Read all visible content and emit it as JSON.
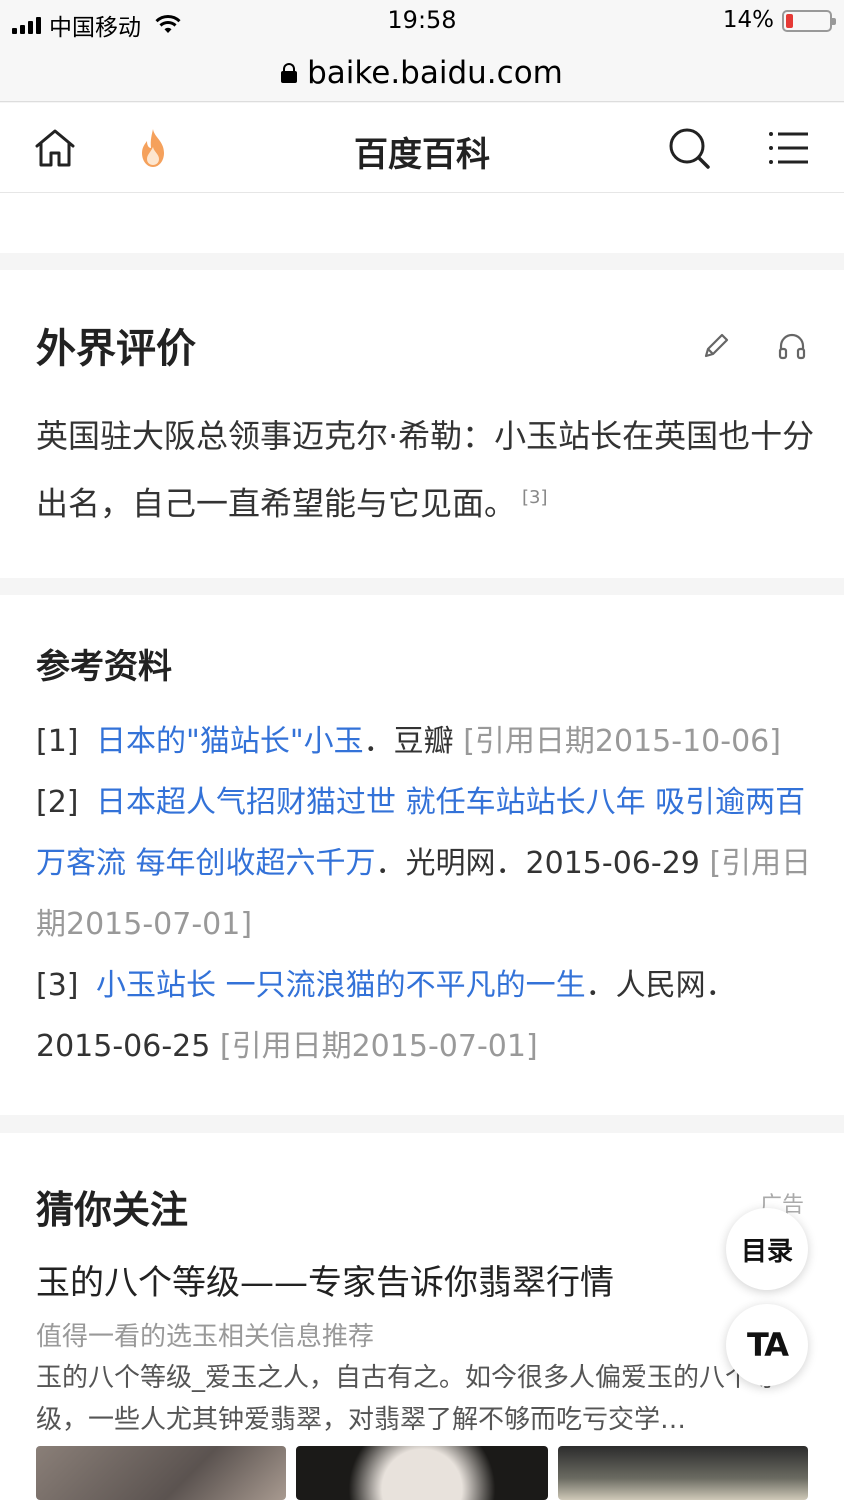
{
  "status_bar": {
    "carrier": "中国移动",
    "time": "19:58",
    "battery": "14%",
    "battery_level": 0.14
  },
  "url_bar": {
    "url": "baike.baidu.com"
  },
  "header": {
    "title": "百度百科",
    "icons": [
      "home-icon",
      "fire-icon",
      "search-icon",
      "menu-icon"
    ]
  },
  "external_review": {
    "title": "外界评价",
    "text": "英国驻大阪总领事迈克尔·希勒：小玉站长在英国也十分出名，自己一直希望能与它见面。",
    "ref": "[3]"
  },
  "references": {
    "title": "参考资料",
    "items": [
      {
        "num": "[1]",
        "link": "日本的\"猫站长\"小玉",
        "source": "．豆瓣 ",
        "cite": "[引用日期2015-10-06]"
      },
      {
        "num": "[2]",
        "link": "日本超人气招财猫过世 就任车站站长八年 吸引逾两百万客流 每年创收超六千万",
        "source": "．光明网．2015-06-29 ",
        "cite": "[引用日期2015-07-01]"
      },
      {
        "num": "[3]",
        "link": "小玉站长 一只流浪猫的不平凡的一生",
        "source": "．人民网．2015-06-25 ",
        "cite": "[引用日期2015-07-01]"
      }
    ]
  },
  "recommend": {
    "title": "猜你关注",
    "ad_label": "广告",
    "ad_title": "玉的八个等级——专家告诉你翡翠行情",
    "ad_subtitle": "值得一看的选玉相关信息推荐",
    "ad_desc": "玉的八个等级_爱玉之人，自古有之。如今很多人偏爱玉的八个等级，一些人尤其钟爱翡翠，对翡翠了解不够而吃亏交学…"
  },
  "fab": {
    "toc": "目录",
    "ta": "TA"
  }
}
